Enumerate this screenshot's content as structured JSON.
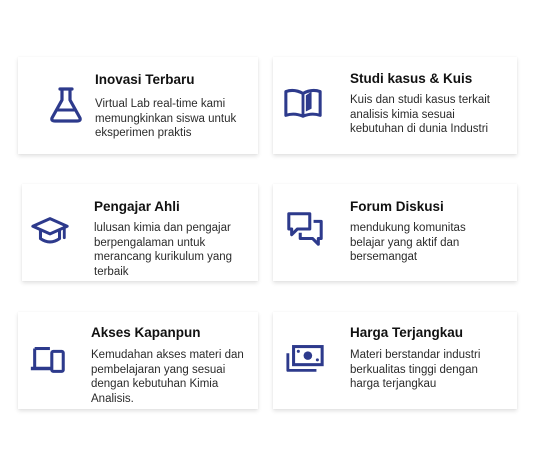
{
  "accent_color": "#2D3A8C",
  "features": [
    {
      "icon": "flask-icon",
      "title": "Inovasi Terbaru",
      "description": "Virtual Lab real-time kami memungkinkan siswa untuk eksperimen praktis"
    },
    {
      "icon": "open-book-icon",
      "title": "Studi kasus & Kuis",
      "description": "Kuis dan studi kasus terkait analisis kimia sesuai kebutuhan di dunia Industri"
    },
    {
      "icon": "graduation-cap-icon",
      "title": "Pengajar Ahli",
      "description": "lulusan kimia dan pengajar berpengalaman untuk merancang kurikulum yang terbaik"
    },
    {
      "icon": "chat-bubbles-icon",
      "title": "Forum Diskusi",
      "description": "mendukung komunitas belajar yang aktif dan bersemangat"
    },
    {
      "icon": "devices-icon",
      "title": "Akses Kapanpun",
      "description": "Kemudahan akses materi dan pembelajaran yang sesuai dengan kebutuhan Kimia Analisis."
    },
    {
      "icon": "money-bill-icon",
      "title": "Harga Terjangkau",
      "description": "Materi berstandar industri berkualitas tinggi dengan harga terjangkau"
    }
  ]
}
